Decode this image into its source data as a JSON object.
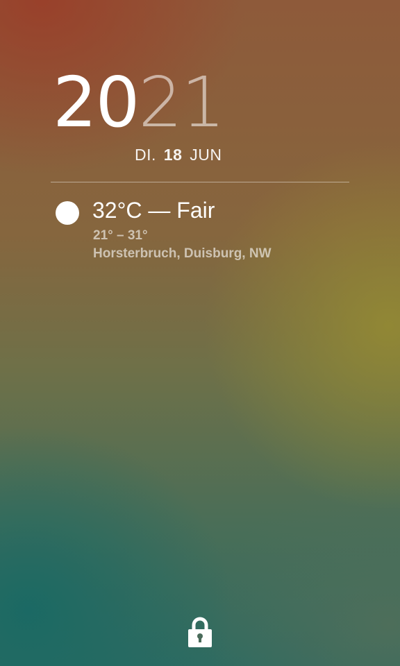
{
  "lockscreen": {
    "clock": {
      "hours": "20",
      "minutes": "21"
    },
    "date": {
      "weekday": "DI.",
      "day": "18",
      "month": "JUN"
    },
    "weather": {
      "icon": "sun-icon",
      "current": "32°C — Fair",
      "range": "21° – 31°",
      "location": "Horsterbruch, Duisburg, NW"
    },
    "unlock_icon": "lock-icon"
  }
}
